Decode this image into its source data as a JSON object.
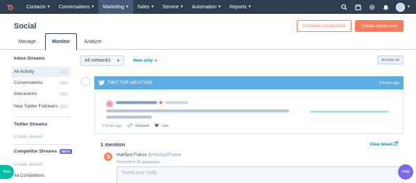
{
  "nav": {
    "items": [
      {
        "label": "Contacts",
        "active": false
      },
      {
        "label": "Conversations",
        "active": false
      },
      {
        "label": "Marketing",
        "active": true
      },
      {
        "label": "Sales",
        "active": false
      },
      {
        "label": "Service",
        "active": false
      },
      {
        "label": "Automation",
        "active": false
      },
      {
        "label": "Reports",
        "active": false
      }
    ],
    "icons": [
      "search-icon",
      "marketplace-icon",
      "gear-icon",
      "bell-icon"
    ]
  },
  "header": {
    "title": "Social",
    "compare_label": "Compare social posts",
    "create_label": "Create social post"
  },
  "tabs": [
    {
      "label": "Manage",
      "active": false
    },
    {
      "label": "Monitor",
      "active": true
    },
    {
      "label": "Analyze",
      "active": false
    }
  ],
  "sidebar": {
    "inbox_heading": "Inbox Streams",
    "inbox_items": [
      {
        "label": "All Activity",
        "active": true
      },
      {
        "label": "Conversations",
        "active": false
      },
      {
        "label": "Interactions",
        "active": false
      },
      {
        "label": "New Twitter Followers",
        "active": false
      }
    ],
    "twitter_heading": "Twitter Streams",
    "twitter_create": "Create stream",
    "competitor_heading": "Competitor Streams",
    "beta_label": "BETA",
    "competitor_create": "Create stream",
    "competitor_all": "All Competitors"
  },
  "filters": {
    "network": "All networks",
    "sort": "New only",
    "archive_label": "Archive all"
  },
  "mention": {
    "title": "TWITTER MENTION",
    "time": "3 hours ago",
    "tweet_time": "3 hours ago",
    "retweet_label": "Retweet",
    "like_label": "Like",
    "count_label": "1 mention",
    "view_label": "View tweet"
  },
  "reply": {
    "name": "HubSpot France",
    "handle": "@HubSpotFrance",
    "replying_prefix": "Replying to @",
    "placeholder": "Tweet your reply"
  },
  "floats": {
    "beta": "Beta",
    "help": "Help"
  },
  "colors": {
    "nav_bg": "#2d3e50",
    "accent": "#ff7a59",
    "twitter": "#5dade2",
    "link": "#0091ae"
  }
}
